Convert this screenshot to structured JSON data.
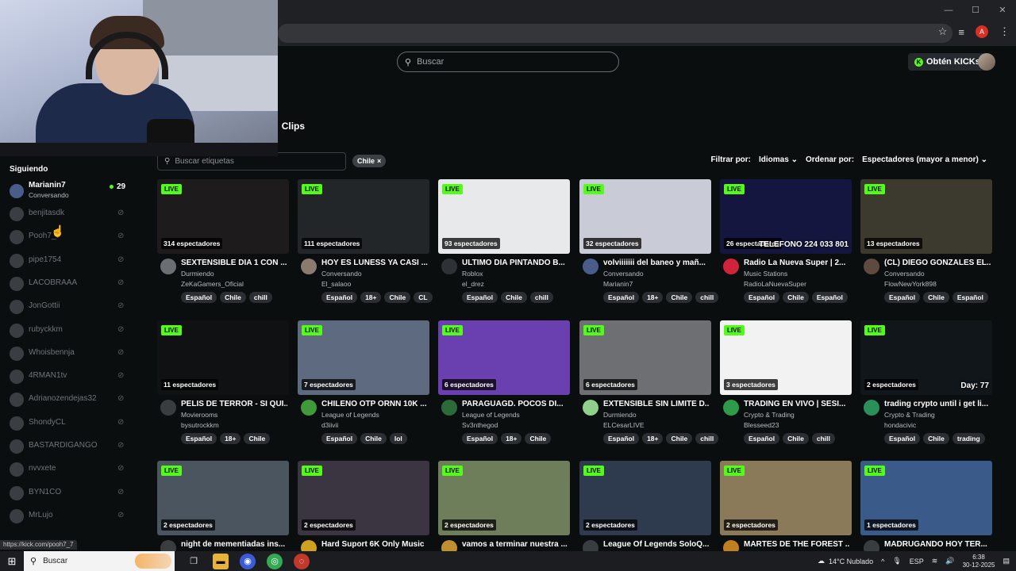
{
  "browser": {
    "window_controls": [
      "—",
      "☐",
      "✕"
    ],
    "profile_initial": "A"
  },
  "header": {
    "search_placeholder": "Buscar",
    "get_kicks_label": "Obtén KICKs"
  },
  "content_tabs": [
    "s",
    "Clips"
  ],
  "sidebar": {
    "title": "Siguiendo",
    "live_channel": {
      "name": "Marianin7",
      "category": "Conversando",
      "viewers": "29"
    },
    "offline_channels": [
      "benjitasdk",
      "Pooh7_7",
      "pipe1754",
      "LACOBRAAA",
      "JonGottii",
      "rubyckkm",
      "Whoisbennja",
      "4RMAN1tv",
      "Adrianozendejas32",
      "ShondyCL",
      "BASTARDIGANGO",
      "nvvxete",
      "BYN1CO",
      "MrLujo"
    ]
  },
  "filters": {
    "tag_search_placeholder": "Buscar etiquetas",
    "active_chip": "Chile",
    "filter_label": "Filtrar por:",
    "language_select": "Idiomas",
    "sort_label": "Ordenar por:",
    "sort_select": "Espectadores (mayor a menor)"
  },
  "live_badge": "LIVE",
  "streams": [
    {
      "viewers": "314 espectadores",
      "title": "SEXTENSIBLE DIA 1 CON ...",
      "category": "Durmiendo",
      "user": "ZeKaGamers_Oficial",
      "tags": [
        "Español",
        "Chile",
        "chill"
      ],
      "color": "#1d1b1c",
      "avatar": "#6b6f73"
    },
    {
      "viewers": "111 espectadores",
      "title": "HOY ES LUNESS YA CASI ...",
      "category": "Conversando",
      "user": "El_salaoo",
      "tags": [
        "Español",
        "18+",
        "Chile",
        "CL"
      ],
      "color": "#222629",
      "avatar": "#8a7a70"
    },
    {
      "viewers": "93 espectadores",
      "title": "ULTIMO DIA PINTANDO B...",
      "category": "Roblox",
      "user": "el_drez",
      "tags": [
        "Español",
        "Chile",
        "chill"
      ],
      "color": "#e8e9ea",
      "avatar": "#2f3235"
    },
    {
      "viewers": "32 espectadores",
      "title": "volviiiiiii del baneo y mañ...",
      "category": "Conversando",
      "user": "Marianin7",
      "tags": [
        "Español",
        "18+",
        "Chile",
        "chill"
      ],
      "color": "#c9ccd6",
      "avatar": "#4a5d8a"
    },
    {
      "viewers": "26 espectadores",
      "title": "Radio La Nueva Super | 2...",
      "category": "Music Stations",
      "user": "RadioLaNuevaSuper",
      "tags": [
        "Español",
        "Chile",
        "Español"
      ],
      "color": "#14163f",
      "avatar": "#d0243a",
      "overlay": "TELEFONO 224 033 801"
    },
    {
      "viewers": "13 espectadores",
      "title": "(CL) DIEGO GONZALES EL...",
      "category": "Conversando",
      "user": "FlowNewYork898",
      "tags": [
        "Español",
        "Chile",
        "Español"
      ],
      "color": "#3c3a2e",
      "avatar": "#5e4b3d"
    },
    {
      "viewers": "11 espectadores",
      "title": "PELIS DE TERROR - SI QUI...",
      "category": "Movierooms",
      "user": "bysutrockkm",
      "tags": [
        "Español",
        "18+",
        "Chile"
      ],
      "color": "#0f1112",
      "avatar": "#3a3d40"
    },
    {
      "viewers": "7 espectadores",
      "title": "CHILENO OTP ORNN 10K ...",
      "category": "League of Legends",
      "user": "d3iivii",
      "tags": [
        "Español",
        "Chile",
        "lol"
      ],
      "color": "#5d6a80",
      "avatar": "#3f9a3a"
    },
    {
      "viewers": "6 espectadores",
      "title": "PARAGUAGD. POCOS DI...",
      "category": "League of Legends",
      "user": "Sv3nthegod",
      "tags": [
        "Español",
        "18+",
        "Chile"
      ],
      "color": "#6a3fb0",
      "avatar": "#2d6a3a"
    },
    {
      "viewers": "6 espectadores",
      "title": "EXTENSIBLE SIN LIMITE D...",
      "category": "Durmiendo",
      "user": "ELCesarLIVE",
      "tags": [
        "Español",
        "18+",
        "Chile",
        "chill"
      ],
      "color": "#6d6f72",
      "avatar": "#8fd08a"
    },
    {
      "viewers": "3 espectadores",
      "title": "TRADING EN VIVO | SESI...",
      "category": "Crypto & Trading",
      "user": "Blesseed23",
      "tags": [
        "Español",
        "Chile",
        "chill"
      ],
      "color": "#f2f2f2",
      "avatar": "#2e9b4a"
    },
    {
      "viewers": "2 espectadores",
      "title": "trading crypto until i get li...",
      "category": "Crypto & Trading",
      "user": "hondacivic",
      "tags": [
        "Español",
        "Chile",
        "trading"
      ],
      "color": "#10161a",
      "avatar": "#2b8f5a",
      "overlay": "Day: 77"
    },
    {
      "viewers": "2 espectadores",
      "title": "night de mementiadas ins...",
      "category": "",
      "user": "",
      "tags": [],
      "color": "#4a5560",
      "avatar": "#3a3d40"
    },
    {
      "viewers": "2 espectadores",
      "title": "Hard Suport 6K Only Music",
      "category": "",
      "user": "",
      "tags": [],
      "color": "#3a3540",
      "avatar": "#d0a020"
    },
    {
      "viewers": "2 espectadores",
      "title": "vamos a terminar nuestra ...",
      "category": "",
      "user": "",
      "tags": [],
      "color": "#6e7d5a",
      "avatar": "#c09030"
    },
    {
      "viewers": "2 espectadores",
      "title": "League Of Legends SoloQ...",
      "category": "",
      "user": "",
      "tags": [],
      "color": "#2e3a4e",
      "avatar": "#3a3d40"
    },
    {
      "viewers": "2 espectadores",
      "title": "MARTES DE THE FOREST ...",
      "category": "",
      "user": "",
      "tags": [],
      "color": "#8b7a5a",
      "avatar": "#c08020"
    },
    {
      "viewers": "1 espectadores",
      "title": "MADRUGANDO HOY TER...",
      "category": "",
      "user": "",
      "tags": [],
      "color": "#3a5a8a",
      "avatar": "#3a3d40"
    }
  ],
  "status_url": "https://kick.com/pooh7_7",
  "taskbar": {
    "search_label": "Buscar",
    "weather": "14°C  Nublado",
    "language": "ESP",
    "time": "6:38",
    "date": "30-12-2025"
  }
}
